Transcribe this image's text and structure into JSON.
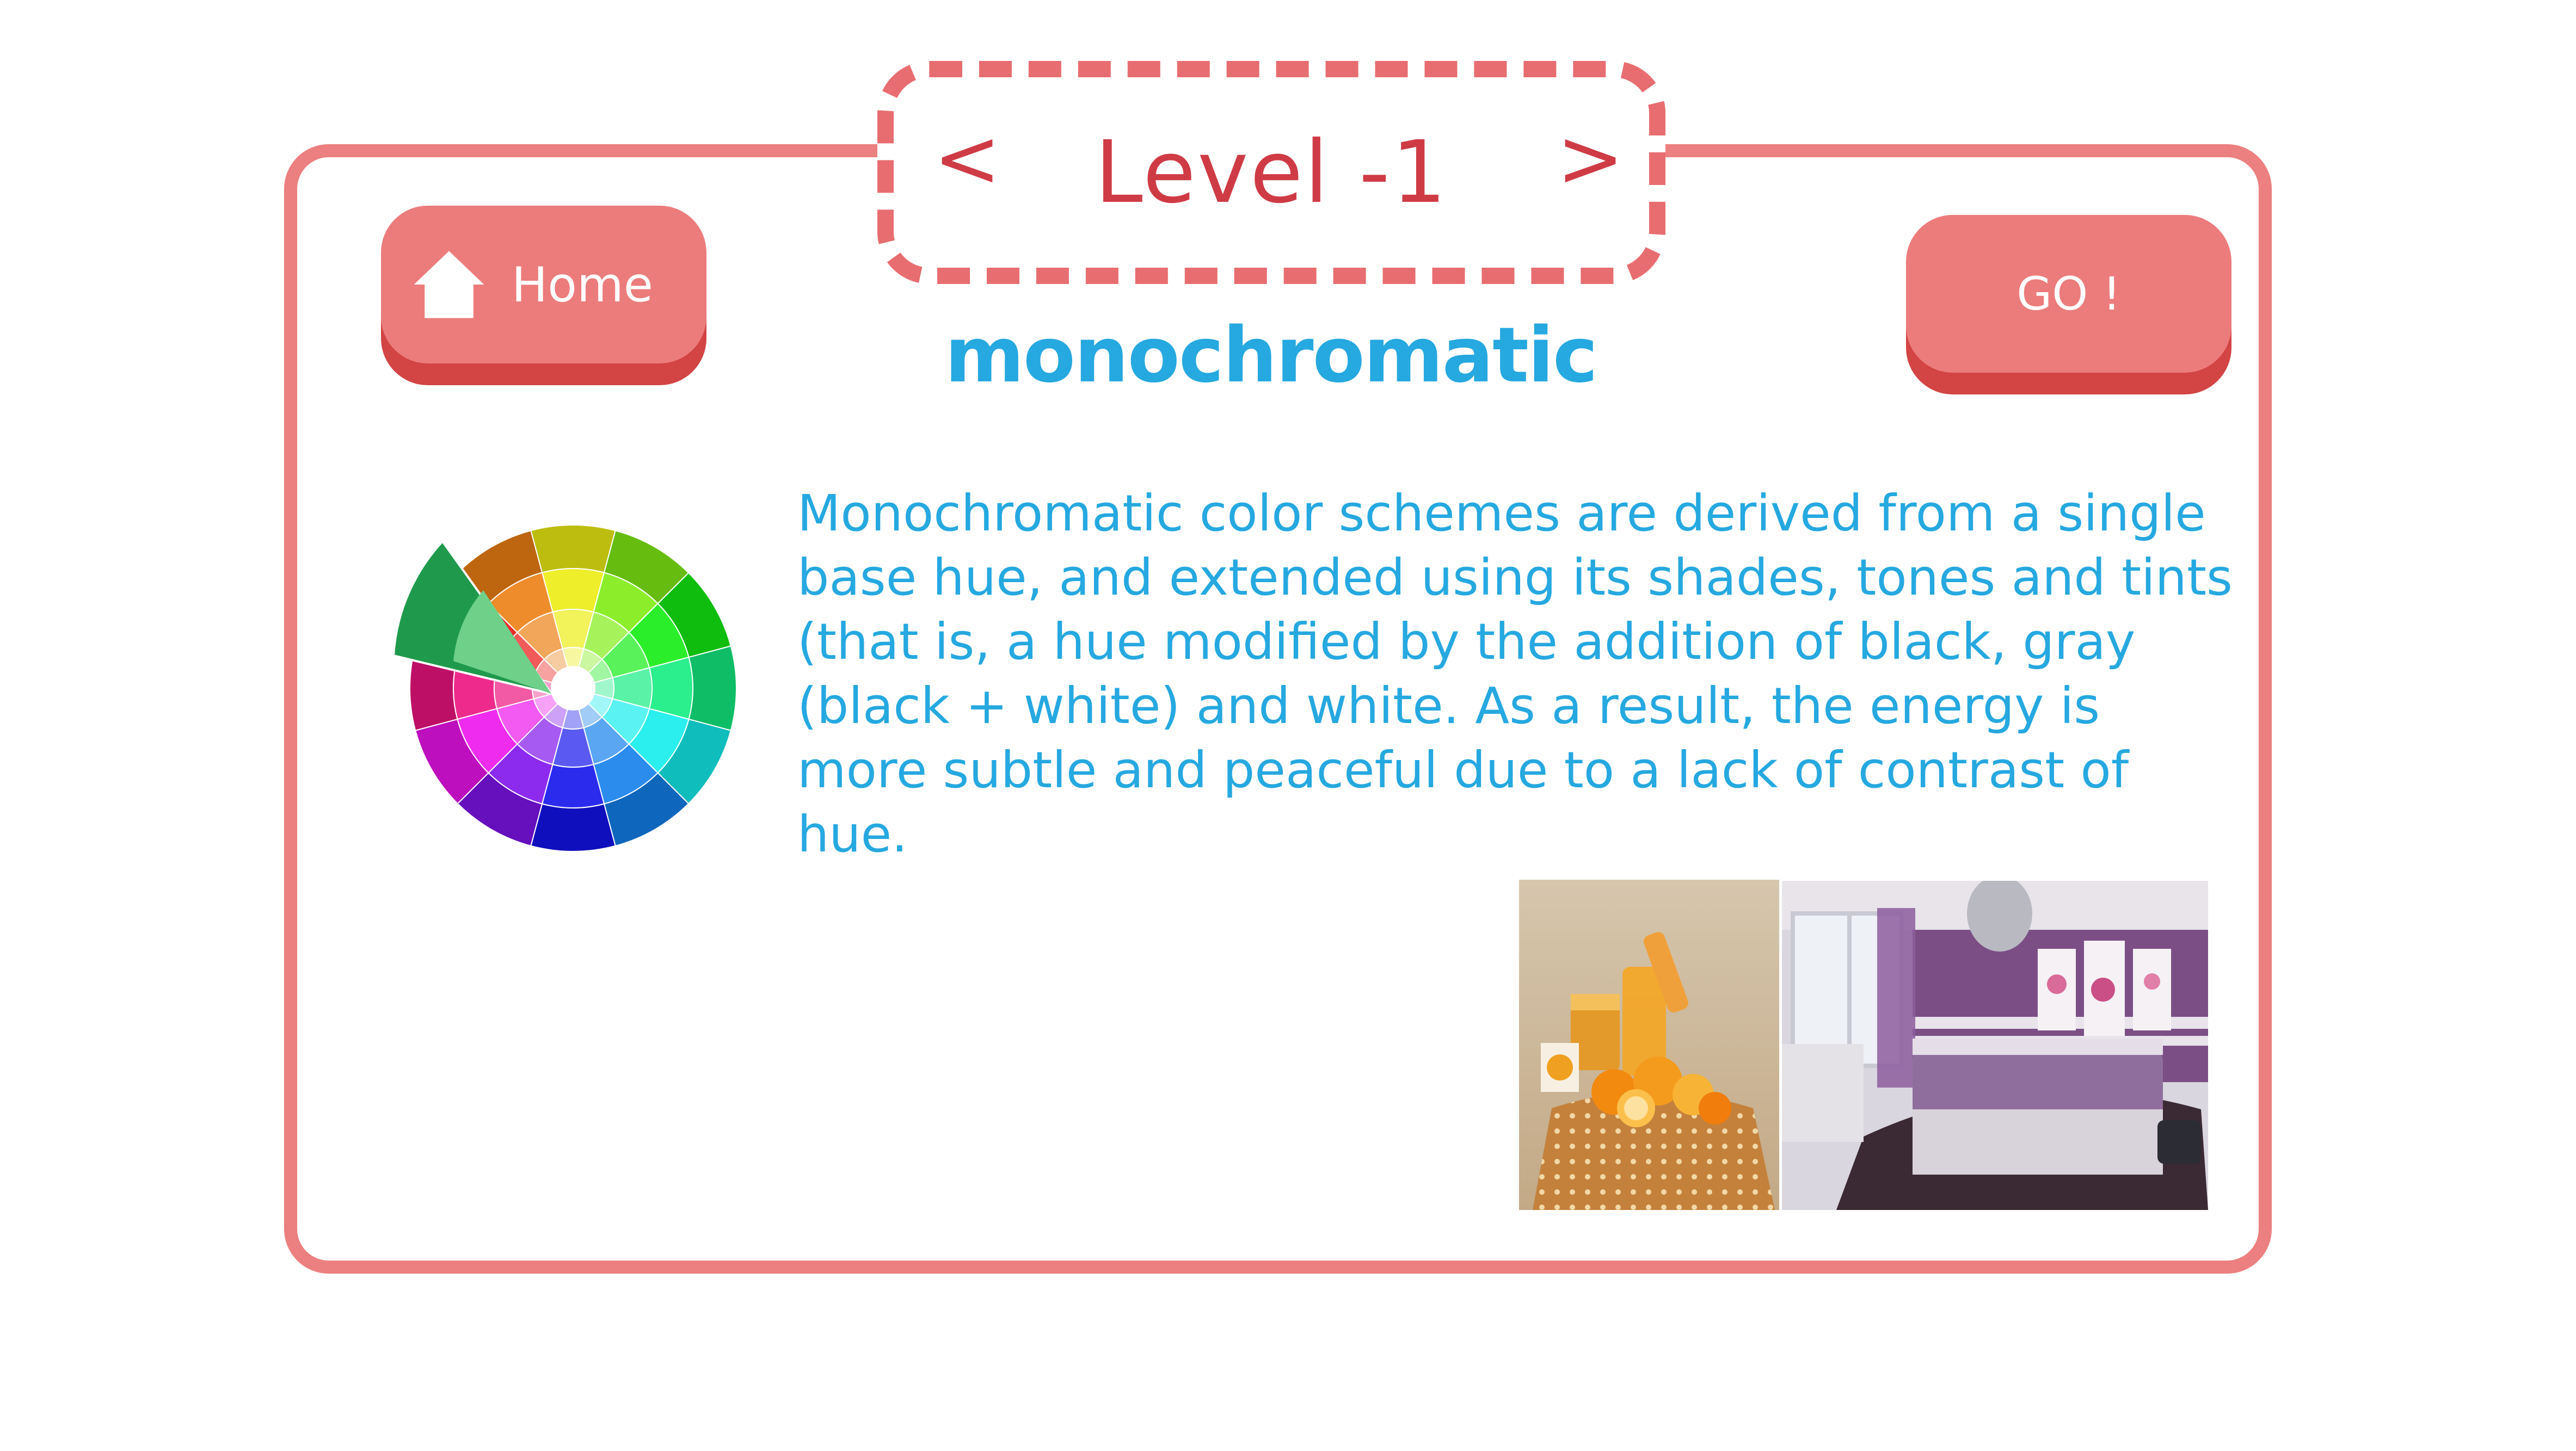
{
  "level": {
    "title": "Level -1",
    "prev": "<",
    "next": ">"
  },
  "home_button": {
    "label": "Home",
    "icon": "home-icon"
  },
  "go_button": {
    "label": "GO !"
  },
  "scheme": {
    "name": "monochromatic",
    "description": "Monochromatic color schemes are derived from a single base hue, and extended using its shades, tones and tints (that is, a hue modified by the addition of black, gray (black + white) and white. As a result, the energy is more subtle and peaceful due to a lack of contrast of hue."
  },
  "colors": {
    "frame": "#ec7f7f",
    "accent_red": "#cf3b45",
    "button": "#ec7c7c",
    "button_shadow": "#d34444",
    "text_blue": "#26a8e0"
  },
  "images": [
    {
      "name": "color-wheel",
      "icon": "color-wheel-icon"
    },
    {
      "name": "orange-still-life"
    },
    {
      "name": "purple-bedroom"
    }
  ]
}
